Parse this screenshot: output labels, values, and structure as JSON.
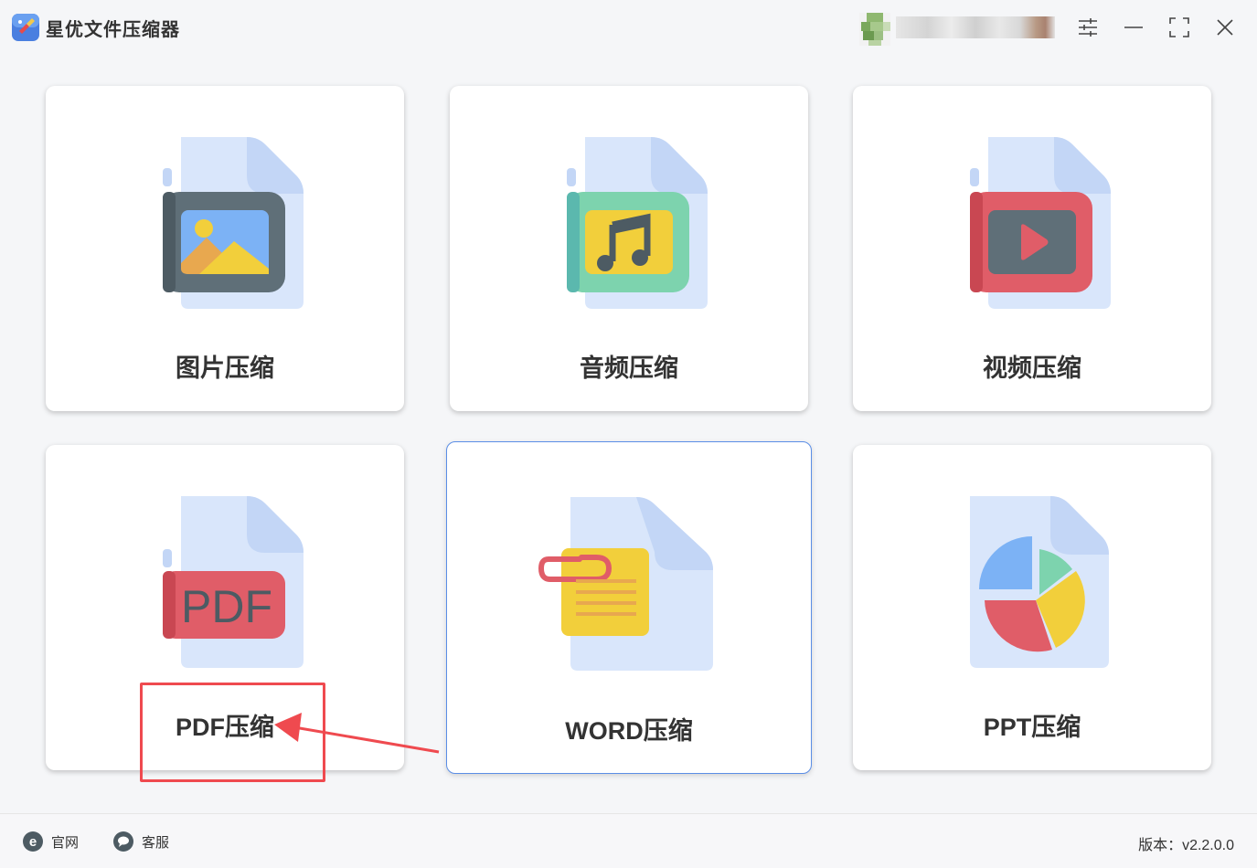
{
  "app": {
    "title": "星优文件压缩器"
  },
  "titlebar": {
    "user_avatar": "avatar-pixelated",
    "buttons": [
      "settings-sliders-icon",
      "minimize-icon",
      "maximize-icon",
      "close-icon"
    ]
  },
  "cards": [
    {
      "label": "图片压缩",
      "icon": "image-file-icon"
    },
    {
      "label": "音频压缩",
      "icon": "audio-file-icon"
    },
    {
      "label": "视频压缩",
      "icon": "video-file-icon"
    },
    {
      "label": "PDF压缩",
      "icon": "pdf-file-icon"
    },
    {
      "label": "WORD压缩",
      "icon": "word-file-icon"
    },
    {
      "label": "PPT压缩",
      "icon": "ppt-file-icon"
    }
  ],
  "icon_text": {
    "pdf": "PDF"
  },
  "footer": {
    "website_label": "官网",
    "support_label": "客服",
    "version_text": "版本：v2.2.0.0"
  },
  "colors": {
    "accent_selected_border": "#5b8ee6",
    "annotation_red": "#ef4a4f"
  }
}
